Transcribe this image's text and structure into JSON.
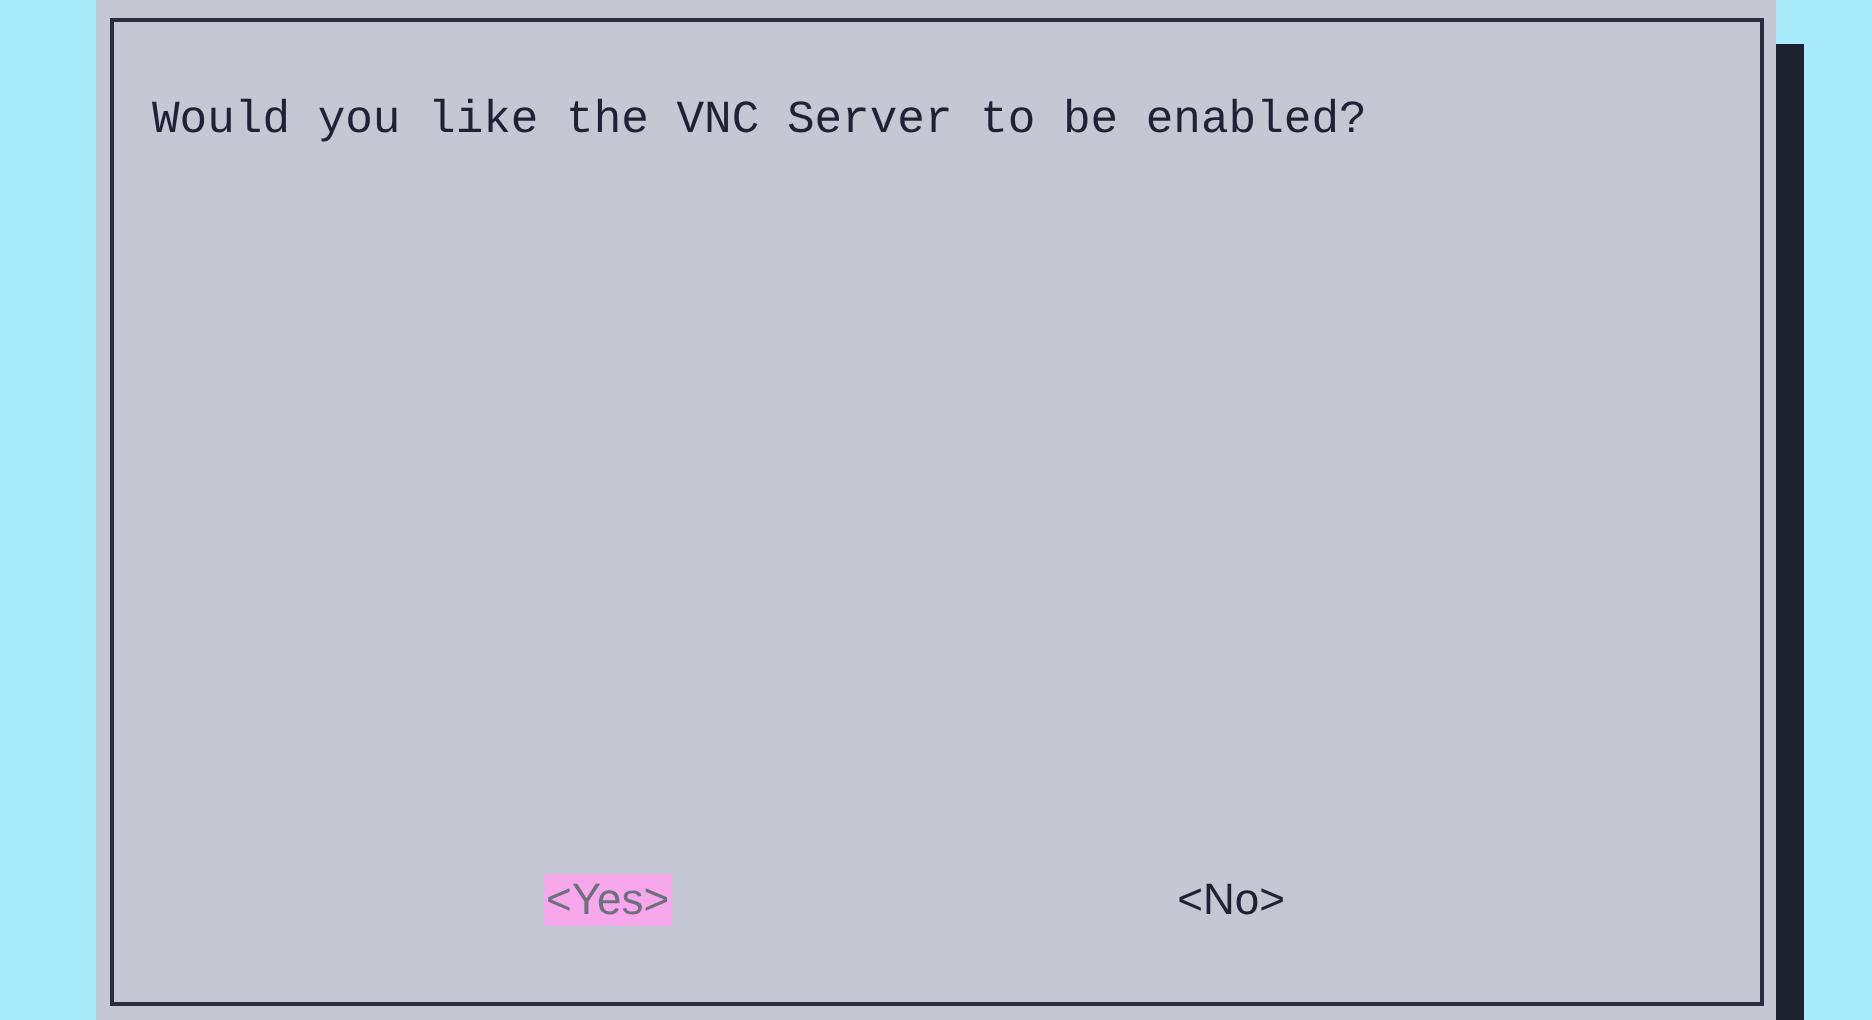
{
  "dialog": {
    "message": "Would you like the VNC Server to be enabled?",
    "buttons": [
      {
        "label": "<Yes>",
        "selected": true
      },
      {
        "label": "<No>",
        "selected": false
      }
    ]
  }
}
